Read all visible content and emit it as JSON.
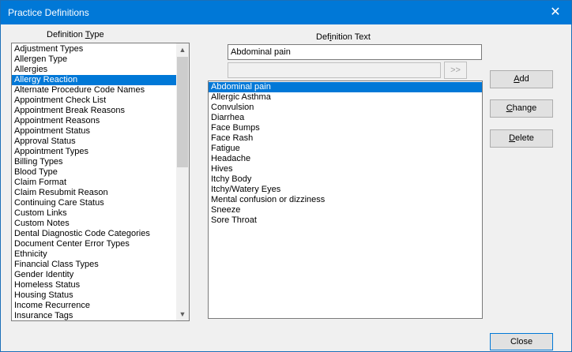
{
  "window": {
    "title": "Practice Definitions",
    "close_glyph": "✕"
  },
  "type_label": {
    "pre": "Definition ",
    "accel": "T",
    "post": "ype"
  },
  "definition_types": [
    "Adjustment Types",
    "Allergen Type",
    "Allergies",
    "Allergy Reaction",
    "Alternate Procedure Code Names",
    "Appointment Check List",
    "Appointment Break Reasons",
    "Appointment Reasons",
    "Appointment Status",
    "Approval Status",
    "Appointment Types",
    "Billing Types",
    "Blood Type",
    "Claim Format",
    "Claim Resubmit Reason",
    "Continuing Care Status",
    "Custom Links",
    "Custom Notes",
    "Dental Diagnostic Code Categories",
    "Document Center Error Types",
    "Ethnicity",
    "Financial Class Types",
    "Gender Identity",
    "Homeless Status",
    "Housing Status",
    "Income Recurrence",
    "Insurance Tags"
  ],
  "selected_type_index": 3,
  "text_label": {
    "pre": "Def",
    "accel": "i",
    "post": "nition Text"
  },
  "definition_text_value": "Abdominal pain",
  "secondary_field_value": "",
  "move_button_label": ">>",
  "definitions": [
    "Abdominal pain",
    "Allergic Asthma",
    "Convulsion",
    "Diarrhea",
    "Face Bumps",
    "Face Rash",
    "Fatigue",
    "Headache",
    "Hives",
    "Itchy Body",
    "Itchy/Watery Eyes",
    "Mental confusion or dizziness",
    "Sneeze",
    "Sore Throat"
  ],
  "selected_definition_index": 0,
  "buttons": {
    "add": {
      "accel": "A",
      "rest": "dd"
    },
    "change": {
      "accel": "C",
      "rest": "hange"
    },
    "delete": {
      "accel": "D",
      "rest": "elete"
    },
    "close": "Close"
  }
}
